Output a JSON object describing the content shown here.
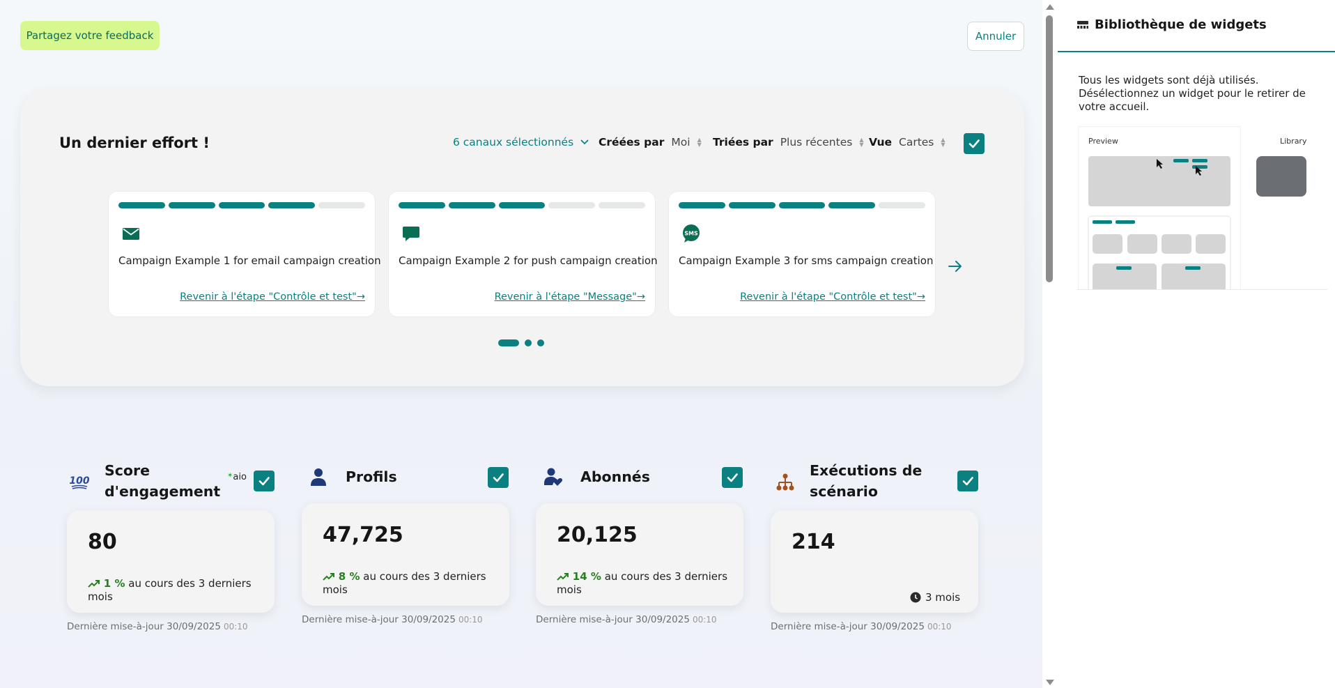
{
  "header": {
    "feedback_label": "Partagez votre feedback",
    "cancel_label": "Annuler"
  },
  "effort": {
    "title": "Un dernier effort !",
    "filters": {
      "channels": "6 canaux sélectionnés",
      "created_label": "Créées par",
      "created_value": "Moi",
      "sorted_label": "Triées par",
      "sorted_value": "Plus récentes",
      "view_label": "Vue",
      "view_value": "Cartes"
    },
    "campaigns": [
      {
        "icon": "email-icon",
        "progress_steps_done": 4,
        "progress_steps_total": 5,
        "text": "Campaign Example 1 for email campaign creation",
        "link": "Revenir à l'étape \"Contrôle et test\"→"
      },
      {
        "icon": "push-chat-icon",
        "progress_steps_done": 3,
        "progress_steps_total": 5,
        "text": "Campaign Example 2 for push campaign creation",
        "link": "Revenir à l'étape \"Message\"→"
      },
      {
        "icon": "sms-icon",
        "progress_steps_done": 4,
        "progress_steps_total": 5,
        "text": "Campaign Example 3 for sms campaign creation",
        "link": "Revenir à l'étape \"Contrôle et test\"→"
      }
    ],
    "pagination": {
      "pages": 3,
      "current": 1
    }
  },
  "metrics": [
    {
      "title": "Score d'engagement",
      "icon": "hundred-points-icon",
      "badge": "aio",
      "value": "80",
      "trend_pct": "1 %",
      "trend_text": " au cours des 3 derniers mois",
      "update_date": "Dernière mise-à-jour 30/09/2025",
      "update_time": "00:10"
    },
    {
      "title": "Profils",
      "icon": "person-icon",
      "value": "47,725",
      "trend_pct": "8 %",
      "trend_text": " au cours des 3 derniers mois",
      "update_date": "Dernière mise-à-jour 30/09/2025",
      "update_time": "00:10"
    },
    {
      "title": "Abonnés",
      "icon": "subscriber-heart-icon",
      "value": "20,125",
      "trend_pct": "14 %",
      "trend_text": " au cours des 3 derniers mois",
      "update_date": "Dernière mise-à-jour 30/09/2025",
      "update_time": "00:10"
    },
    {
      "title": "Exécutions de scénario",
      "icon": "scenario-tree-icon",
      "value": "214",
      "period": "3 mois",
      "update_date": "Dernière mise-à-jour 30/09/2025",
      "update_time": "00:10"
    }
  ],
  "side_panel": {
    "title": "Bibliothèque de widgets",
    "description": "Tous les widgets sont déjà utilisés. Désélectionnez un widget pour le retirer de votre accueil.",
    "preview_label": "Preview",
    "library_label": "Library"
  },
  "colors": {
    "accent": "#0a8080",
    "feedback_bg": "#d6f88e",
    "trend_green": "#27811e"
  }
}
